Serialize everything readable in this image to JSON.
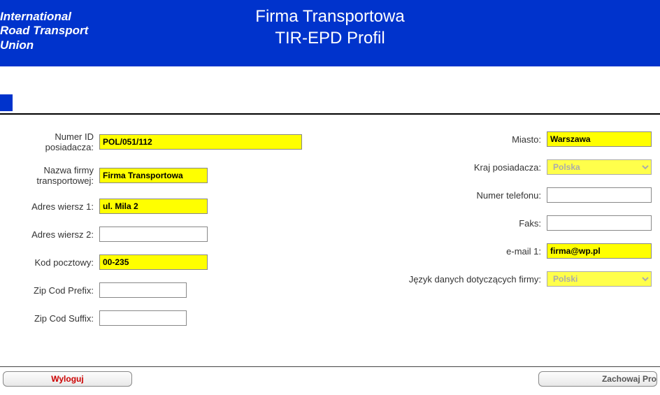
{
  "header": {
    "logo_line1": "International",
    "logo_line2": "Road Transport",
    "logo_line3": "Union",
    "title_line1": "Firma Transportowa",
    "title_line2": "TIR-EPD Profil"
  },
  "labels": {
    "holder_id": "Numer ID posiadacza:",
    "company_name": "Nazwa firmy transportowej:",
    "address1": "Adres wiersz 1:",
    "address2": "Adres wiersz 2:",
    "postal_code": "Kod pocztowy:",
    "zip_prefix": "Zip Cod Prefix:",
    "zip_suffix": "Zip Cod Suffix:",
    "city": "Miasto:",
    "holder_country": "Kraj posiadacza:",
    "phone": "Numer telefonu:",
    "fax": "Faks:",
    "email1": "e-mail 1:",
    "company_lang": "Język danych dotyczących firmy:"
  },
  "values": {
    "holder_id": "POL/051/112",
    "company_name": "Firma Transportowa",
    "address1": "ul. Mila 2",
    "address2": "",
    "postal_code": "00-235",
    "zip_prefix": "",
    "zip_suffix": "",
    "city": "Warszawa",
    "holder_country": "Polska",
    "phone": "",
    "fax": "",
    "email1": "firma@wp.pl",
    "company_lang": "Polski"
  },
  "buttons": {
    "logout": "Wyloguj",
    "save": "Zachowaj Pro"
  }
}
